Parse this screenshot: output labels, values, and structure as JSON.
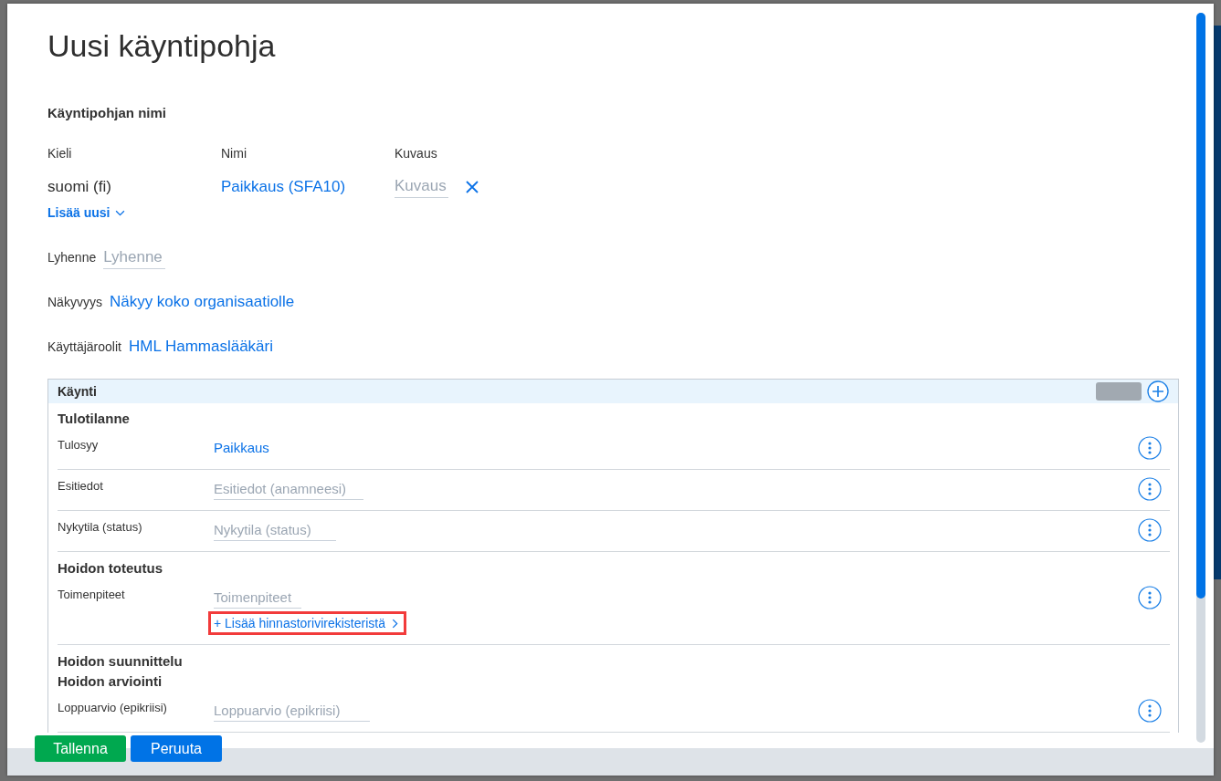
{
  "dialog": {
    "title": "Uusi käyntipohja"
  },
  "name_section": {
    "heading": "Käyntipohjan nimi",
    "columns": [
      "Kieli",
      "Nimi",
      "Kuvaus"
    ],
    "rows": [
      {
        "language": "suomi (fi)",
        "name": "Paikkaus (SFA10)",
        "description_placeholder": "Kuvaus"
      }
    ],
    "add_button": "Lisää uusi"
  },
  "fields": [
    {
      "kind": "input",
      "label": "Lyhenne",
      "placeholder": "Lyhenne"
    },
    {
      "kind": "link",
      "label": "Näkyvyys",
      "value": "Näkyy koko organisaatiolle"
    },
    {
      "kind": "link",
      "label": "Käyttäjäroolit",
      "value": "HML Hammaslääkäri"
    }
  ],
  "visit_panel": {
    "title": "Käynti",
    "sections": [
      {
        "heading": "Tulotilanne",
        "rows": [
          {
            "kind": "link",
            "label": "Tulosyy",
            "value": "Paikkaus"
          },
          {
            "kind": "input",
            "label": "Esitiedot",
            "placeholder": "Esitiedot (anamneesi)"
          },
          {
            "kind": "input",
            "label": "Nykytila (status)",
            "placeholder": "Nykytila (status)"
          }
        ]
      },
      {
        "heading": "Hoidon toteutus",
        "rows": [
          {
            "kind": "input",
            "label": "Toimenpiteet",
            "placeholder": "Toimenpiteet",
            "add_link": {
              "text": "+ Lisää hinnastorivirekisteristä",
              "highlighted": true
            }
          }
        ]
      },
      {
        "heading": "Hoidon suunnittelu"
      },
      {
        "heading": "Hoidon arviointi",
        "rows": [
          {
            "kind": "input",
            "label": "Loppuarvio (epikriisi)",
            "placeholder": "Loppuarvio (epikriisi)"
          }
        ]
      }
    ]
  },
  "buttons": [
    {
      "kind": "success",
      "label": "Tallenna"
    },
    {
      "kind": "primary",
      "label": "Peruuta"
    }
  ]
}
